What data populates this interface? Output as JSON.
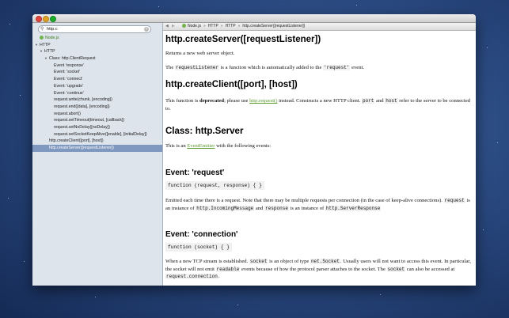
{
  "search": {
    "value": "http.c"
  },
  "sidebar": {
    "items": [
      {
        "label": "Node.js",
        "indent": 0,
        "tri": "",
        "icon": true,
        "selected": false
      },
      {
        "label": "HTTP",
        "indent": 0,
        "tri": "▼",
        "icon": false,
        "selected": false
      },
      {
        "label": "HTTP",
        "indent": 1,
        "tri": "▼",
        "icon": false,
        "selected": false
      },
      {
        "label": "Class: http.ClientRequest",
        "indent": 2,
        "tri": "▼",
        "icon": false,
        "selected": false
      },
      {
        "label": "Event 'response'",
        "indent": 3,
        "tri": "",
        "icon": false,
        "selected": false
      },
      {
        "label": "Event: 'socket'",
        "indent": 3,
        "tri": "",
        "icon": false,
        "selected": false
      },
      {
        "label": "Event: 'connect'",
        "indent": 3,
        "tri": "",
        "icon": false,
        "selected": false
      },
      {
        "label": "Event: 'upgrade'",
        "indent": 3,
        "tri": "",
        "icon": false,
        "selected": false
      },
      {
        "label": "Event: 'continue'",
        "indent": 3,
        "tri": "",
        "icon": false,
        "selected": false
      },
      {
        "label": "request.write(chunk, [encoding])",
        "indent": 3,
        "tri": "",
        "icon": false,
        "selected": false
      },
      {
        "label": "request.end([data], [encoding])",
        "indent": 3,
        "tri": "",
        "icon": false,
        "selected": false
      },
      {
        "label": "request.abort()",
        "indent": 3,
        "tri": "",
        "icon": false,
        "selected": false
      },
      {
        "label": "request.setTimeout(timeout, [callback])",
        "indent": 3,
        "tri": "",
        "icon": false,
        "selected": false
      },
      {
        "label": "request.setNoDelay([noDelay])",
        "indent": 3,
        "tri": "",
        "icon": false,
        "selected": false
      },
      {
        "label": "request.setSocketKeepAlive([enable], [initialDelay])",
        "indent": 3,
        "tri": "",
        "icon": false,
        "selected": false
      },
      {
        "label": "http.createClient([port], [host])",
        "indent": 2,
        "tri": "",
        "icon": false,
        "selected": false
      },
      {
        "label": "http.createServer([requestListener])",
        "indent": 2,
        "tri": "",
        "icon": false,
        "selected": true
      }
    ]
  },
  "pathbar": {
    "back": "◀",
    "forward": "▶",
    "crumbs": [
      "Node.js",
      "HTTP",
      "HTTP",
      "http.createServer([requestListener])"
    ],
    "sep": "»"
  },
  "article": {
    "h_create_server": "http.createServer([requestListener])",
    "p1": "Returns a new web server object.",
    "p2_a": "The ",
    "p2_code": "requestListener",
    "p2_b": " is a function which is automatically added to the ",
    "p2_code2": "'request'",
    "p2_c": " event.",
    "h_create_client": "http.createClient([port], [host])",
    "p3_a": "This function is ",
    "p3_bold": "deprecated",
    "p3_b": "; please use ",
    "p3_link": "http.request()",
    "p3_c": " instead. Constructs a new HTTP client. ",
    "p3_code1": "port",
    "p3_d": " and ",
    "p3_code2": "host",
    "p3_e": " refer to the server to be connected to.",
    "h_class_server": "Class: http.Server",
    "p4_a": "This is an ",
    "p4_link": "EventEmitter",
    "p4_b": " with the following events:",
    "h_event_request": "Event: 'request'",
    "code_request": "function (request, response) { }",
    "p5_a": "Emitted each time there is a request. Note that there may be multiple requests per connection (in the case of keep-alive connections). ",
    "p5_code1": "request",
    "p5_b": " is an instance of ",
    "p5_code2": "http.IncomingMessage",
    "p5_c": " and ",
    "p5_code3": "response",
    "p5_d": " is an instance of ",
    "p5_code4": "http.ServerResponse",
    "h_event_connection": "Event: 'connection'",
    "code_connection": "function (socket) { }",
    "p6_a": "When a new TCP stream is established. ",
    "p6_code1": "socket",
    "p6_b": " is an object of type ",
    "p6_code2": "net.Socket",
    "p6_c": ". Usually users will not want to access this event. In particular, the socket will not emit ",
    "p6_code3": "readable",
    "p6_d": " events because of how the protocol parser attaches to the socket. The ",
    "p6_code4": "socket",
    "p6_e": " can also be accessed at ",
    "p6_code5": "request.connection",
    "p6_f": "."
  }
}
